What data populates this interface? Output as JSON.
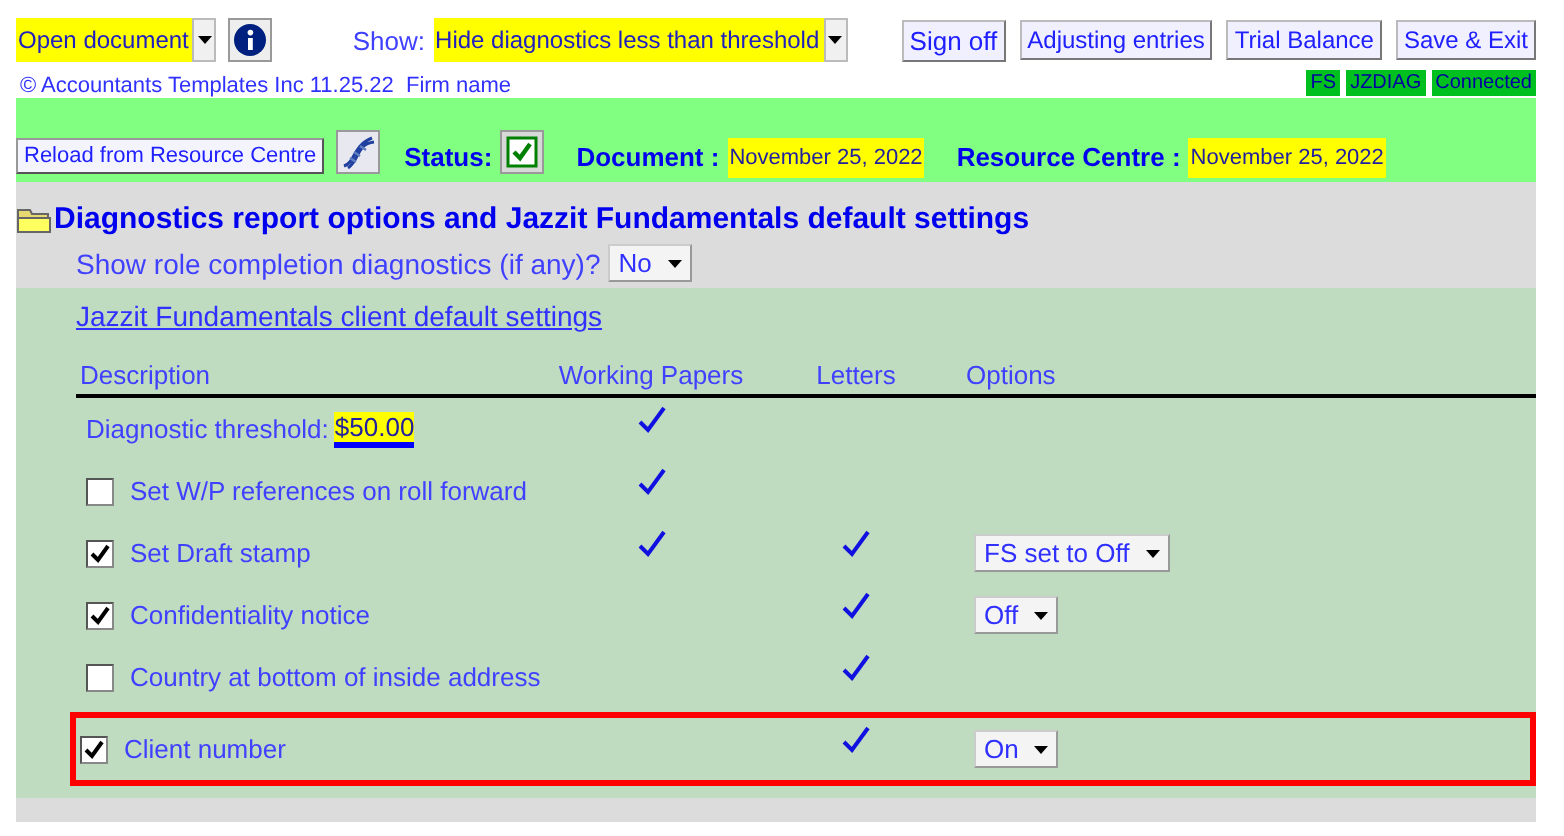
{
  "toolbar": {
    "document_select": "Open document",
    "show_label": "Show:",
    "show_select": "Hide diagnostics less than threshold",
    "buttons": [
      "Sign off",
      "Adjusting entries",
      "Trial Balance",
      "Save & Exit"
    ]
  },
  "info_line": {
    "copyright": "© Accountants Templates Inc 11.25.22  Firm name",
    "badges": [
      "FS",
      "JZDIAG",
      "Connected"
    ]
  },
  "status_bar": {
    "reload_button": "Reload from Resource Centre",
    "status_label": "Status:",
    "status_checked": true,
    "document_label": "Document :",
    "document_date": "November 25, 2022",
    "resource_label": "Resource Centre :",
    "resource_date": "November 25, 2022"
  },
  "section": {
    "title": "Diagnostics report options and Jazzit Fundamentals default settings",
    "role_question": "Show role completion diagnostics (if any)?",
    "role_value": "No",
    "defaults_link": "Jazzit Fundamentals client default settings",
    "columns": [
      "Description",
      "Working Papers",
      "Letters",
      "Options"
    ],
    "rows": [
      {
        "kind": "threshold",
        "label": "Diagnostic threshold:",
        "value": "$50.00",
        "working_papers": true,
        "letters": false,
        "highlighted": false
      },
      {
        "kind": "checkbox",
        "label": "Set W/P references on roll forward",
        "checked": false,
        "working_papers": true,
        "letters": false,
        "highlighted": false
      },
      {
        "kind": "checkbox",
        "label": "Set Draft stamp",
        "checked": true,
        "working_papers": true,
        "letters": true,
        "option": "FS set to Off",
        "highlighted": false
      },
      {
        "kind": "checkbox",
        "label": "Confidentiality notice",
        "checked": true,
        "working_papers": false,
        "letters": true,
        "option": "Off",
        "highlighted": false
      },
      {
        "kind": "checkbox",
        "label": "Country at bottom of inside address",
        "checked": false,
        "working_papers": false,
        "letters": true,
        "highlighted": false
      },
      {
        "kind": "checkbox",
        "label": "Client number",
        "checked": true,
        "working_papers": false,
        "letters": true,
        "option": "On",
        "highlighted": true
      }
    ]
  }
}
